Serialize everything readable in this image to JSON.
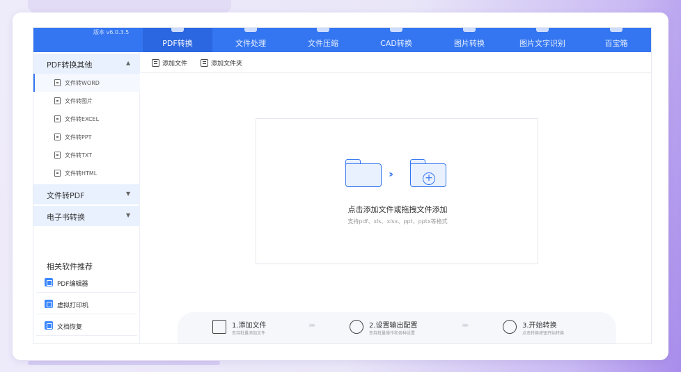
{
  "app": {
    "version": "版本 v6.0.3.5"
  },
  "tabs": [
    {
      "label": "PDF转换",
      "icon": "pdf-convert-icon",
      "active": true
    },
    {
      "label": "文件处理",
      "icon": "file-process-icon",
      "active": false
    },
    {
      "label": "文件压缩",
      "icon": "file-compress-icon",
      "active": false
    },
    {
      "label": "CAD转换",
      "icon": "cad-convert-icon",
      "active": false
    },
    {
      "label": "图片转换",
      "icon": "image-convert-icon",
      "active": false
    },
    {
      "label": "图片文字识别",
      "icon": "ocr-icon",
      "active": false
    },
    {
      "label": "百宝箱",
      "icon": "toolbox-icon",
      "active": false
    }
  ],
  "sidebar": {
    "section1": {
      "label": "PDF转换其他",
      "expanded": true
    },
    "items": [
      {
        "label": "文件转WORD",
        "icon": "word-file-icon",
        "active": true
      },
      {
        "label": "文件转图片",
        "icon": "image-file-icon",
        "active": false
      },
      {
        "label": "文件转EXCEL",
        "icon": "excel-file-icon",
        "active": false
      },
      {
        "label": "文件转PPT",
        "icon": "ppt-file-icon",
        "active": false
      },
      {
        "label": "文件转TXT",
        "icon": "txt-file-icon",
        "active": false
      },
      {
        "label": "文件转HTML",
        "icon": "html-file-icon",
        "active": false
      }
    ],
    "section2": {
      "label": "文件转PDF",
      "expanded": false
    },
    "section3": {
      "label": "电子书转换",
      "expanded": false
    },
    "recommend": {
      "title": "相关软件推荐",
      "items": [
        {
          "label": "PDF编辑器",
          "icon": "pdf-editor-icon"
        },
        {
          "label": "虚拟打印机",
          "icon": "virtual-printer-icon"
        },
        {
          "label": "文档恢复",
          "icon": "document-recovery-icon"
        }
      ]
    }
  },
  "toolbar": {
    "add_file": "添加文件",
    "add_folder": "添加文件夹"
  },
  "dropzone": {
    "main": "点击添加文件或拖拽文件添加",
    "sub": "支持pdf、xls、xlsx、ppt、pptx等格式"
  },
  "steps": [
    {
      "title": "1.添加文件",
      "desc": "支持批量添加文件",
      "icon": "folder-step-icon"
    },
    {
      "title": "2.设置输出配置",
      "desc": "支持批量操作和各种设置",
      "icon": "settings-step-icon"
    },
    {
      "title": "3.开始转换",
      "desc": "点击转换按钮开始转换",
      "icon": "convert-step-icon"
    }
  ],
  "colors": {
    "primary": "#3476f1",
    "sidebar_section_bg": "#e9f1fe"
  }
}
